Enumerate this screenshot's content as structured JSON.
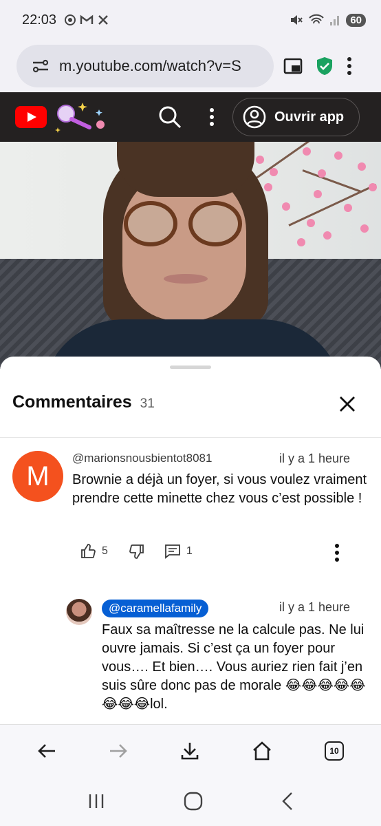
{
  "status_bar": {
    "time": "22:03",
    "battery": "60",
    "left_icons": [
      "chrome-icon",
      "gmail-icon",
      "x-icon"
    ],
    "right_icons": [
      "mute-icon",
      "wifi-icon",
      "signal-icon"
    ]
  },
  "browser": {
    "url": "m.youtube.com/watch?v=S",
    "tab_count": "10"
  },
  "youtube": {
    "open_app_label": "Ouvrir app"
  },
  "comments": {
    "title": "Commentaires",
    "count": "31",
    "items": [
      {
        "author": "@marionsnousbientot8081",
        "avatar_letter": "M",
        "time": "il y a 1 heure",
        "text": "Brownie a déjà un foyer, si vous voulez vraiment prendre cette minette chez vous c’est possible !",
        "likes": "5",
        "replies": "1"
      },
      {
        "author": "@caramellafamily",
        "time": "il y a 1 heure",
        "text": "Faux sa maîtresse ne la calcule pas. Ne lui ouvre jamais. Si c’est ça un foyer pour vous…. Et bien…. Vous auriez rien fait j’en suis sûre donc pas de morale 😂😂😂😂😂😂😂😂lol."
      }
    ]
  },
  "colors": {
    "youtube_red": "#ff0000",
    "avatar_orange": "#f4511e",
    "mention_blue": "#065fd4",
    "shield_green": "#1aa260"
  }
}
